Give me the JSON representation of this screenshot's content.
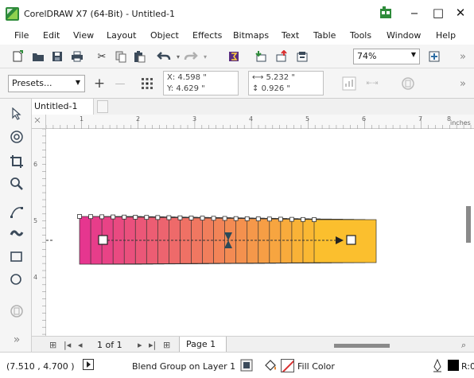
{
  "window": {
    "title": "CorelDRAW X7 (64-Bit) - Untitled-1"
  },
  "window_controls": {
    "minimize": "‒",
    "maximize": "□",
    "close": "✕"
  },
  "menu": [
    {
      "label": "File",
      "underline": "F"
    },
    {
      "label": "Edit",
      "underline": "E"
    },
    {
      "label": "View",
      "underline": "V"
    },
    {
      "label": "Layout",
      "underline": "L"
    },
    {
      "label": "Object",
      "underline": "j"
    },
    {
      "label": "Effects",
      "underline": "c"
    },
    {
      "label": "Bitmaps",
      "underline": "B"
    },
    {
      "label": "Text",
      "underline": "x"
    },
    {
      "label": "Table",
      "underline": "T"
    },
    {
      "label": "Tools",
      "underline": "o"
    },
    {
      "label": "Window",
      "underline": "W"
    },
    {
      "label": "Help",
      "underline": "H"
    }
  ],
  "toolbar": {
    "zoom": "74%",
    "overflow": "»"
  },
  "propbar": {
    "presets": "Presets...",
    "add": "+",
    "remove": "—",
    "x": "X: 4.598 \"",
    "y": "Y: 4.629 \"",
    "w": "5.232 \"",
    "h": "0.926 \"",
    "overflow": "»"
  },
  "document": {
    "tab": "Untitled-1"
  },
  "ruler": {
    "units": "inches",
    "h_ticks": [
      "1",
      "2",
      "3",
      "4",
      "5",
      "6",
      "7",
      "8"
    ],
    "v_ticks": [
      "6",
      "5",
      "4"
    ]
  },
  "pagebar": {
    "counter": "1 of 1",
    "page_tab": "Page 1"
  },
  "status": {
    "coords": "(7.510 , 4.700 )",
    "object_info": "Blend Group on Layer 1",
    "fill_label": "Fill Color",
    "outline_label": "R:0"
  },
  "blend": {
    "start_color": "#e6368f",
    "end_color": "#fbbf2e",
    "steps": 22
  }
}
